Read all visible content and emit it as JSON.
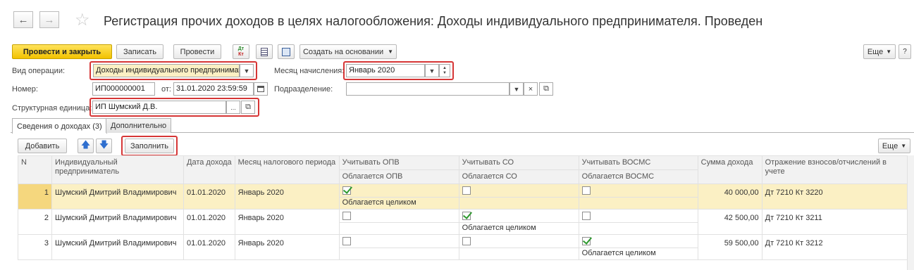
{
  "header": {
    "title": "Регистрация прочих доходов в целях налогообложения: Доходы индивидуального предпринимателя. Проведен"
  },
  "toolbar": {
    "post_close": "Провести и закрыть",
    "save": "Записать",
    "post": "Провести",
    "dtkt_top": "Дт",
    "dtkt_bottom": "Кт",
    "create_based": "Создать на основании",
    "more": "Еще"
  },
  "form": {
    "op_type_label": "Вид операции:",
    "op_type_value": "Доходы индивидуального предпринимателя",
    "month_label": "Месяц начисления:",
    "month_value": "Январь 2020",
    "number_label": "Номер:",
    "number_value": "ИП000000001",
    "from_label": "от:",
    "date_value": "31.01.2020 23:59:59",
    "division_label": "Подразделение:",
    "division_value": "",
    "struct_label": "Структурная единица:",
    "struct_value": "ИП Шумский Д.В."
  },
  "tabs": [
    {
      "label": "Сведения о доходах (3)"
    },
    {
      "label": "Дополнительно"
    }
  ],
  "table_toolbar": {
    "add": "Добавить",
    "fill": "Заполнить",
    "more": "Еще"
  },
  "table": {
    "headers": {
      "n": "N",
      "entrepreneur": "Индивидуальный предприниматель",
      "date": "Дата дохода",
      "month": "Месяц налогового периода",
      "opv": "Учитывать ОПВ",
      "opv_sub": "Облагается ОПВ",
      "so": "Учитывать СО",
      "so_sub": "Облагается СО",
      "vosms": "Учитывать ВОСМС",
      "vosms_sub": "Облагается ВОСМС",
      "amount": "Сумма дохода",
      "reflection": "Отражение взносов/отчислений в учете"
    },
    "rows": [
      {
        "n": "1",
        "name": "Шумский Дмитрий Владимирович",
        "date": "01.01.2020",
        "month": "Январь 2020",
        "opv": true,
        "so": false,
        "vosms": false,
        "taxed_text": "Облагается целиком",
        "amount": "40 000,00",
        "reflection": "Дт 7210 Кт 3220"
      },
      {
        "n": "2",
        "name": "Шумский Дмитрий Владимирович",
        "date": "01.01.2020",
        "month": "Январь 2020",
        "opv": false,
        "so": true,
        "vosms": false,
        "taxed_text": "Облагается целиком",
        "amount": "42 500,00",
        "reflection": "Дт 7210 Кт 3211"
      },
      {
        "n": "3",
        "name": "Шумский Дмитрий Владимирович",
        "date": "01.01.2020",
        "month": "Январь 2020",
        "opv": false,
        "so": false,
        "vosms": true,
        "taxed_text": "Облагается целиком",
        "amount": "59 500,00",
        "reflection": "Дт 7210 Кт 3212"
      }
    ]
  },
  "colors": {
    "primary_button": "#f2c200",
    "selected_row": "#fbf0c4",
    "highlight_box": "#d63636",
    "checkmark": "#2e9a2e"
  }
}
